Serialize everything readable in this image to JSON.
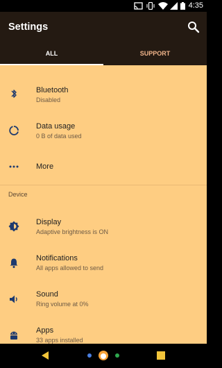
{
  "status_bar": {
    "time": "4:35",
    "icons": [
      "cast-icon",
      "vibrate-icon",
      "wifi-icon",
      "signal-icon",
      "battery-icon"
    ]
  },
  "app_bar": {
    "title": "Settings",
    "tabs": [
      {
        "label": "ALL",
        "selected": true
      },
      {
        "label": "SUPPORT",
        "selected": false
      }
    ]
  },
  "settings": {
    "bluetooth": {
      "title": "Bluetooth",
      "subtitle": "Disabled",
      "icon": "bluetooth-icon"
    },
    "data_usage": {
      "title": "Data usage",
      "subtitle": "0 B of data used",
      "icon": "data-usage-icon"
    },
    "more": {
      "title": "More",
      "icon": "more-dots-icon"
    },
    "device_header": "Device",
    "display": {
      "title": "Display",
      "subtitle": "Adaptive brightness is ON",
      "icon": "brightness-icon"
    },
    "notifications": {
      "title": "Notifications",
      "subtitle": "All apps allowed to send",
      "icon": "bell-icon"
    },
    "sound": {
      "title": "Sound",
      "subtitle": "Ring volume at 0%",
      "icon": "volume-icon"
    },
    "apps": {
      "title": "Apps",
      "subtitle": "33 apps installed",
      "icon": "android-icon"
    }
  },
  "colors": {
    "content_bg": "#fecd82",
    "app_bar_bg": "#241a12",
    "icon_color": "#1e3a6e",
    "tab_unselected": "#f0b48a"
  },
  "nav_bar": {
    "buttons": [
      "back-icon",
      "home-icon",
      "recents-icon"
    ]
  }
}
